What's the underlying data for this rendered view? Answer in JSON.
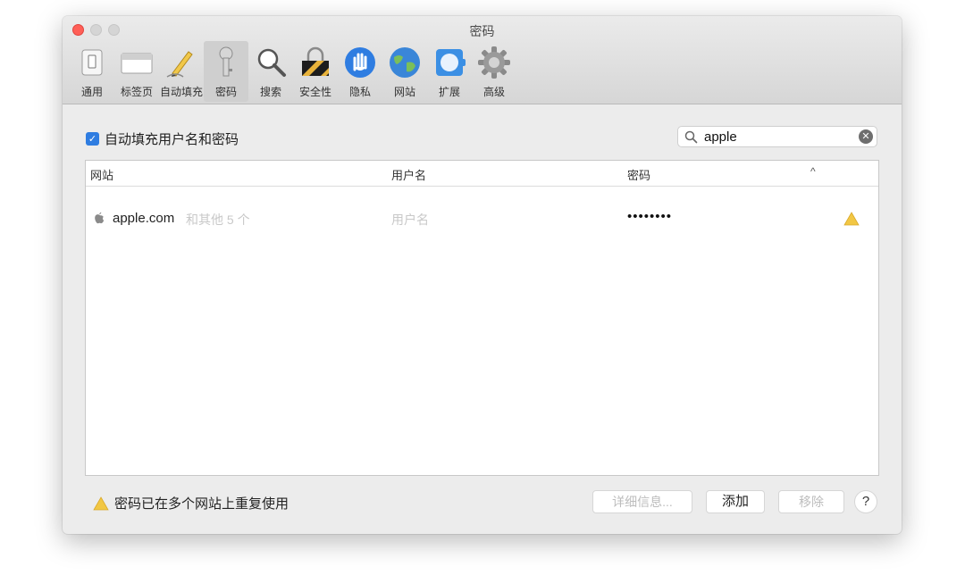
{
  "window": {
    "title": "密码"
  },
  "toolbar": {
    "items": [
      {
        "label": "通用",
        "icon": "general-icon"
      },
      {
        "label": "标签页",
        "icon": "tabs-icon"
      },
      {
        "label": "自动填充",
        "icon": "autofill-pencil-icon"
      },
      {
        "label": "密码",
        "icon": "key-icon",
        "selected": true
      },
      {
        "label": "搜索",
        "icon": "search-magnifier-icon"
      },
      {
        "label": "安全性",
        "icon": "security-lock-icon"
      },
      {
        "label": "隐私",
        "icon": "privacy-hand-icon"
      },
      {
        "label": "网站",
        "icon": "globe-icon"
      },
      {
        "label": "扩展",
        "icon": "extensions-icon"
      },
      {
        "label": "高级",
        "icon": "gear-icon"
      }
    ]
  },
  "autofill": {
    "label": "自动填充用户名和密码",
    "checked": true
  },
  "search": {
    "value": "apple"
  },
  "table": {
    "columns": [
      "网站",
      "用户名",
      "密码"
    ],
    "sort_indicator": "^",
    "rows": [
      {
        "site": "apple.com",
        "extra": "和其他 5 个",
        "username": "用户名",
        "password": "••••••••",
        "warning": true
      }
    ]
  },
  "footer": {
    "warning_text": "密码已在多个网站上重复使用",
    "details_label": "详细信息...",
    "add_label": "添加",
    "remove_label": "移除",
    "help_label": "?"
  },
  "colors": {
    "accent": "#2f7de1",
    "close": "#ff5f57",
    "warning": "#f2c744"
  }
}
